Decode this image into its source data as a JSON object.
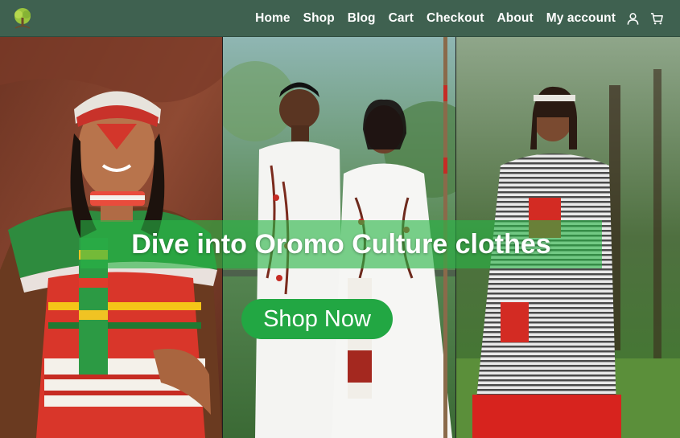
{
  "nav": {
    "logo_icon": "tree-logo-icon",
    "links": [
      "Home",
      "Shop",
      "Blog",
      "Cart",
      "Checkout",
      "About",
      "My account"
    ],
    "icons": [
      "user-icon",
      "cart-icon"
    ],
    "bar_color": "#3f6150"
  },
  "hero": {
    "headline": "Dive into Oromo Culture clothes",
    "cta_label": "Shop Now",
    "cta_color": "#22a743",
    "band_color": "#28b446"
  }
}
